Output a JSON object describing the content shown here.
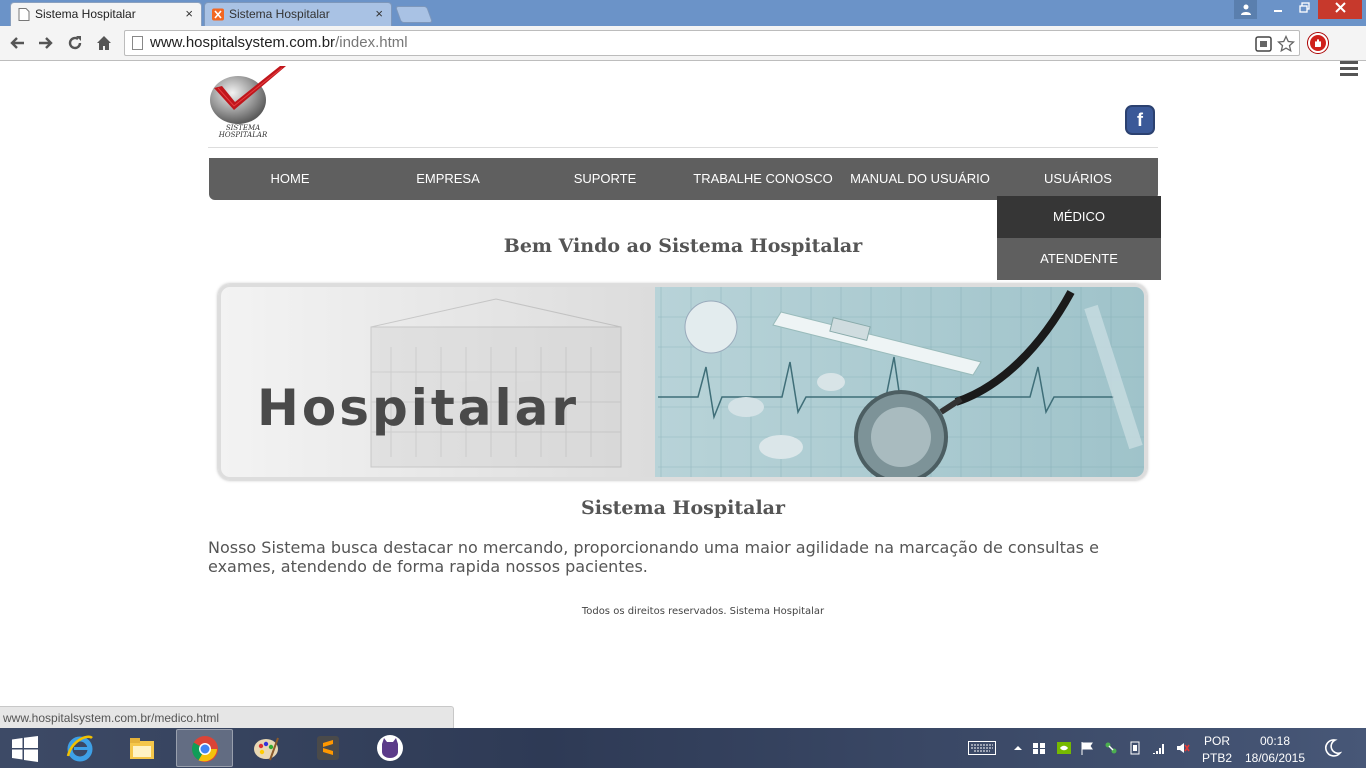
{
  "browser": {
    "tabs": [
      {
        "title": "Sistema Hospitalar",
        "active": true
      },
      {
        "title": "Sistema Hospitalar",
        "active": false
      }
    ],
    "close_glyph": "×",
    "url_host": "www.hospitalsystem.com.br",
    "url_path": "/index.html",
    "status_url": "www.hospitalsystem.com.br/medico.html"
  },
  "site": {
    "logo_line1": "SISTEMA",
    "logo_line2": "HOSPITALAR",
    "facebook_glyph": "f",
    "nav": [
      "HOME",
      "EMPRESA",
      "SUPORTE",
      "TRABALHE CONOSCO",
      "MANUAL DO USUÁRIO",
      "USUÁRIOS"
    ],
    "dropdown": [
      "MÉDICO",
      "ATENDENTE"
    ],
    "welcome": "Bem Vindo ao Sistema Hospitalar",
    "banner_word": "Hospitalar",
    "subtitle": "Sistema Hospitalar",
    "description": "Nosso Sistema busca destacar no mercando, proporcionando uma maior agilidade na marcação de consultas e exames, atendendo de forma rapida nossos pacientes.",
    "footer": "Todos os direitos reservados. Sistema Hospitalar"
  },
  "taskbar": {
    "lang_top": "POR",
    "lang_bottom": "PTB2",
    "time": "00:18",
    "date": "18/06/2015"
  },
  "colors": {
    "nav_bg": "#5f5f5f",
    "dropdown_hover": "#363636",
    "logo_red": "#c0161c",
    "facebook": "#3b5998"
  }
}
